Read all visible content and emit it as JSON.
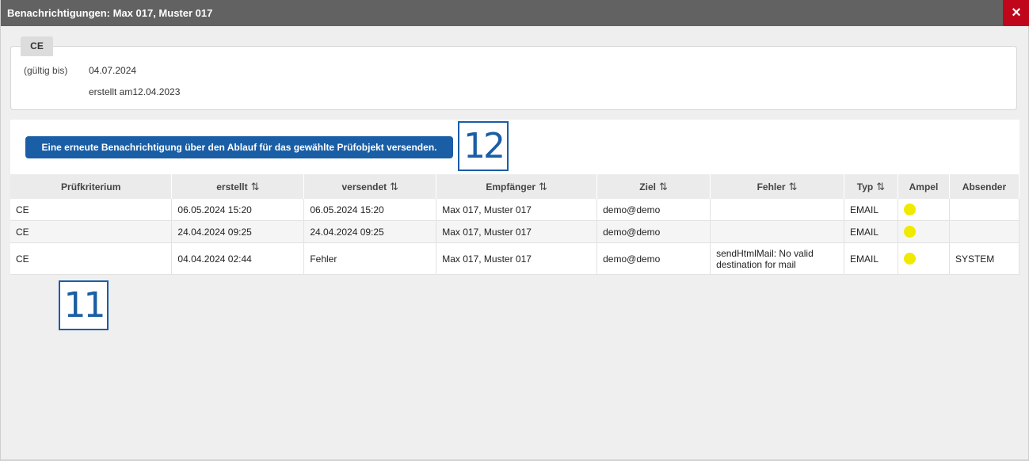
{
  "window": {
    "title": "Benachrichtigungen: Max 017, Muster 017",
    "close_icon": "×"
  },
  "info": {
    "tag": "CE",
    "valid_label": "(gültig bis)",
    "valid_value": "04.07.2024",
    "created": "erstellt am12.04.2023"
  },
  "actions": {
    "resend_label": "Eine erneute Benachrichtigung über den Ablauf für das gewählte Prüfobjekt versenden."
  },
  "callouts": {
    "button": "12",
    "table": "11"
  },
  "table": {
    "sort_icon": "⇅",
    "headers": {
      "pruefkriterium": "Prüfkriterium",
      "erstellt": "erstellt",
      "versendet": "versendet",
      "empfaenger": "Empfänger",
      "ziel": "Ziel",
      "fehler": "Fehler",
      "typ": "Typ",
      "ampel": "Ampel",
      "absender": "Absender"
    },
    "rows": [
      {
        "pruefkriterium": "CE",
        "erstellt": "06.05.2024 15:20",
        "versendet": "06.05.2024 15:20",
        "empfaenger": "Max 017, Muster 017",
        "ziel": "demo@demo",
        "fehler": "",
        "typ": "EMAIL",
        "ampel": "yellow",
        "absender": ""
      },
      {
        "pruefkriterium": "CE",
        "erstellt": "24.04.2024 09:25",
        "versendet": "24.04.2024 09:25",
        "empfaenger": "Max 017, Muster 017",
        "ziel": "demo@demo",
        "fehler": "",
        "typ": "EMAIL",
        "ampel": "yellow",
        "absender": ""
      },
      {
        "pruefkriterium": "CE",
        "erstellt": "04.04.2024 02:44",
        "versendet": "Fehler",
        "empfaenger": "Max 017, Muster 017",
        "ziel": "demo@demo",
        "fehler": "sendHtmlMail: No valid destination for mail",
        "typ": "EMAIL",
        "ampel": "yellow",
        "absender": "SYSTEM"
      }
    ]
  },
  "colors": {
    "titlebar": "#626262",
    "close": "#c0061a",
    "accent": "#1a5ea5",
    "ampel_yellow": "#f0ea00"
  }
}
